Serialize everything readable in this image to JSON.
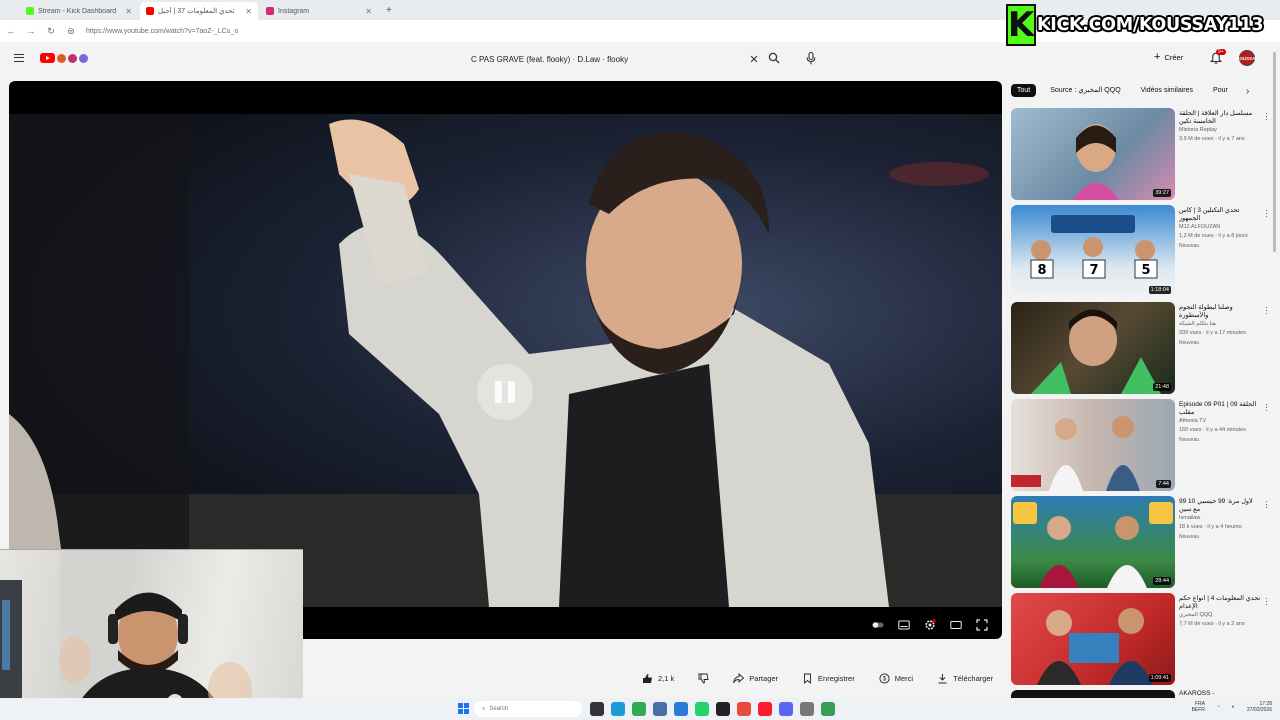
{
  "browser": {
    "tabs": [
      {
        "title": "Stream - Kick Dashboard",
        "color": "#53fc18",
        "active": false
      },
      {
        "title": "تحدي المعلومات 37 | أجيل",
        "color": "#ff0000",
        "active": true
      },
      {
        "title": "Instagram",
        "color": "#d62976",
        "active": false
      }
    ],
    "new_tab": "+",
    "url": "https://www.youtube.com/watch?v=7aoZ-_LCu_o"
  },
  "youtube": {
    "search_query": "C PAS GRAVE (feat. flooky) · D.Law · flooky",
    "create_label": "Créer",
    "notification_count": "9+",
    "avatar_text": "KOUSSAY"
  },
  "stream_overlay": {
    "kick_letter": "K",
    "kick_url": "KICK.COM/KOUSSAY113"
  },
  "actions": {
    "likes": "2,1 k",
    "share": "Partager",
    "save": "Enregistrer",
    "thanks": "Merci",
    "download": "Télécharger"
  },
  "chips": [
    "Tout",
    "Source : المخبري QQQ",
    "Vidéos similaires",
    "Pour"
  ],
  "recommendations": [
    {
      "title": "مسلسل دار العلاقة | الحلقة الخامسة تكين",
      "channel": "Mistoria Replay",
      "views": "3,9 M de vues · il y a 7 ans",
      "duration": "39:27",
      "badge": "",
      "thumb_color": "#7a9bb5"
    },
    {
      "title": "تحدي التكتلين 3 | كأس الجمهور",
      "channel": "M12 ALFOUZAN",
      "views": "1,2 M de vues · il y a 8 jours",
      "duration": "1:18:04",
      "badge": "Nouveau",
      "thumb_color": "#2f6fb0"
    },
    {
      "title": "وصلنا لبطولة النجوم والأسطورة",
      "channel": "هنا بتكلم الشبكة",
      "views": "209 vues · il y a 17 minutes",
      "duration": "21:48",
      "badge": "Nouveau",
      "thumb_color": "#3a3020"
    },
    {
      "title": "Episode 09 P01 | الحلقة 09 مقلب",
      "channel": "Athenia TV",
      "views": "160 vues · il y a 44 minutes",
      "duration": "7:44",
      "badge": "Nouveau",
      "thumb_color": "#c8c0bc"
    },
    {
      "title": "99 لأول مرة: 99 حيسبي 10 مع سين",
      "channel": "Ismailaw",
      "views": "18 k vues · il y a 4 heures",
      "duration": "28:44",
      "badge": "Nouveau",
      "thumb_color": "#2a6e3a"
    },
    {
      "title": "تحدي المعلومات 4 | أنواع حكم الإعدام",
      "channel": "المخبري QQQ",
      "views": "7,7 M de vues · il y a 2 ans",
      "duration": "1:09:41",
      "badge": "",
      "thumb_color": "#d04040"
    }
  ],
  "next_rec_partial": "AKAROSS -",
  "taskbar": {
    "search_placeholder": "Search",
    "lang": "FRA",
    "lang_sub": "BEFR",
    "time": "17:28",
    "date": "27/02/2026"
  }
}
